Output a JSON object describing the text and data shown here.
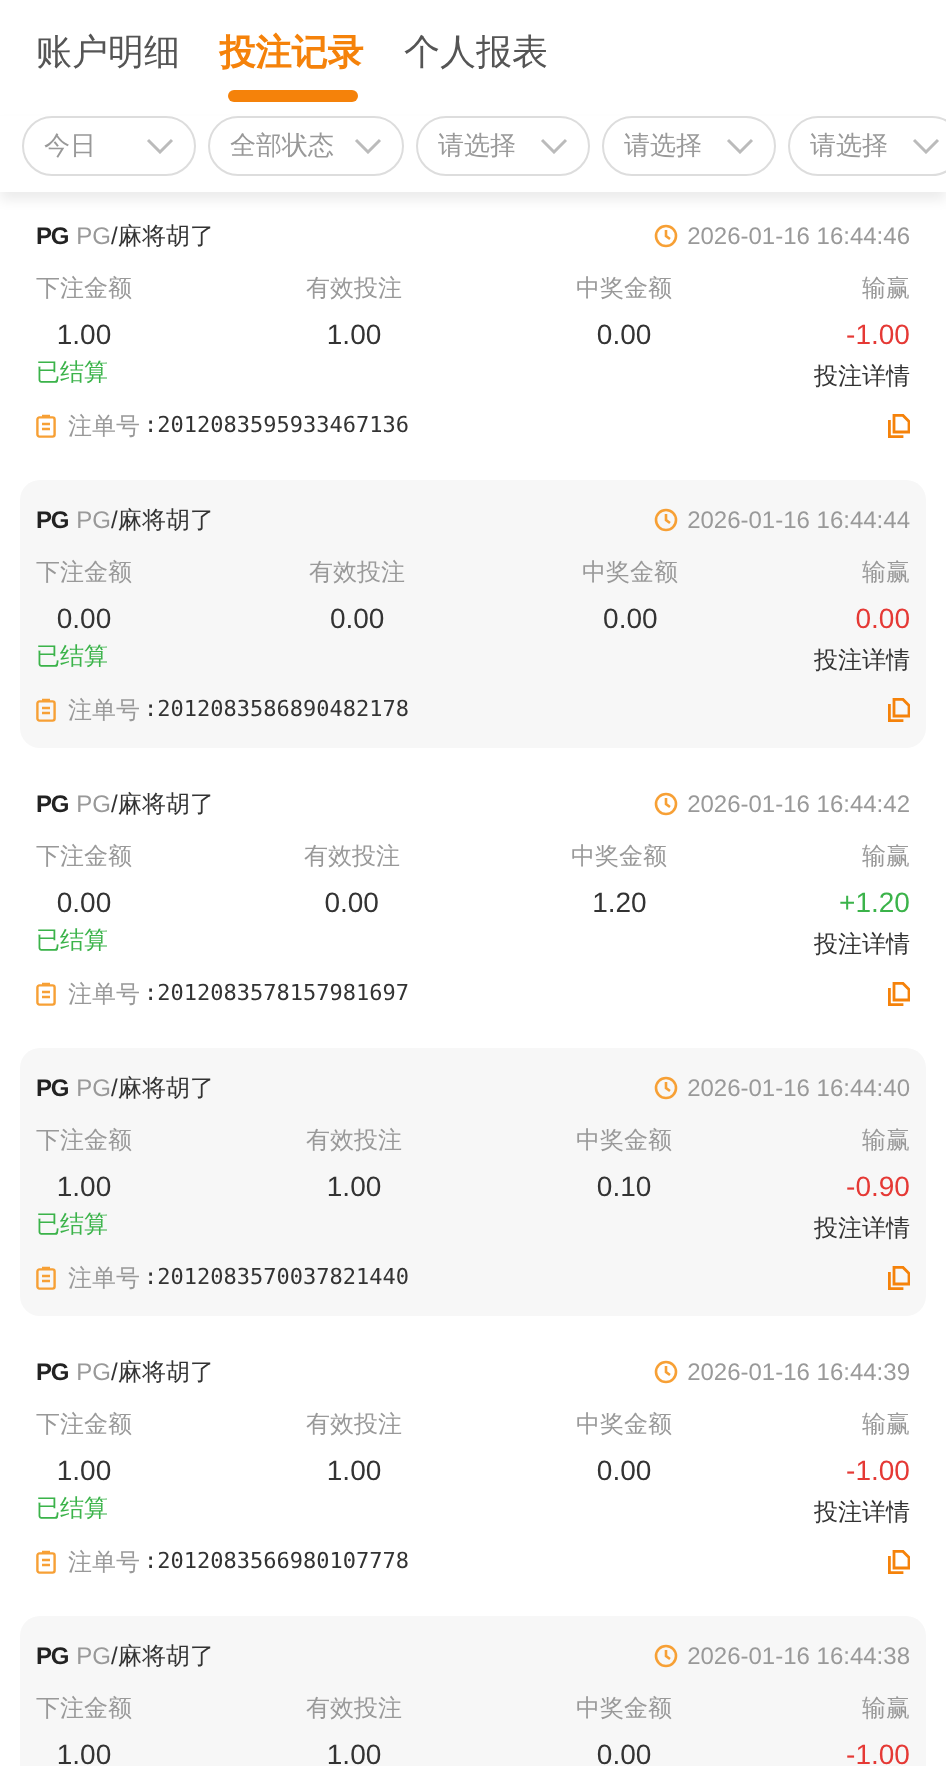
{
  "tabs": [
    {
      "label": "账户明细",
      "selected": false
    },
    {
      "label": "投注记录",
      "selected": true
    },
    {
      "label": "个人报表",
      "selected": false
    }
  ],
  "filters": [
    "今日",
    "全部状态",
    "请选择",
    "请选择",
    "请选择"
  ],
  "records": [
    {
      "logo": "PG",
      "provider": "PG",
      "game": "/麻将胡了",
      "time": "2026-01-16 16:44:46",
      "columns": [
        "下注金额",
        "有效投注",
        "中奖金额",
        "输赢"
      ],
      "values": [
        "1.00",
        "1.00",
        "0.00"
      ],
      "profit": "-1.00",
      "color": "#e53935",
      "status": "已结算",
      "detail": "投注详情",
      "order_label": "注单号",
      "order_no": ":2012083595933467136"
    },
    {
      "logo": "PG",
      "provider": "PG",
      "game": "/麻将胡了",
      "time": "2026-01-16 16:44:44",
      "columns": [
        "下注金额",
        "有效投注",
        "中奖金额",
        "输赢"
      ],
      "values": [
        "0.00",
        "0.00",
        "0.00"
      ],
      "profit": "0.00",
      "color": "#e53935",
      "status": "已结算",
      "detail": "投注详情",
      "order_label": "注单号",
      "order_no": ":2012083586890482178"
    },
    {
      "logo": "PG",
      "provider": "PG",
      "game": "/麻将胡了",
      "time": "2026-01-16 16:44:42",
      "columns": [
        "下注金额",
        "有效投注",
        "中奖金额",
        "输赢"
      ],
      "values": [
        "0.00",
        "0.00",
        "1.20"
      ],
      "profit": "+1.20",
      "color": "#3bb34a",
      "status": "已结算",
      "detail": "投注详情",
      "order_label": "注单号",
      "order_no": ":2012083578157981697"
    },
    {
      "logo": "PG",
      "provider": "PG",
      "game": "/麻将胡了",
      "time": "2026-01-16 16:44:40",
      "columns": [
        "下注金额",
        "有效投注",
        "中奖金额",
        "输赢"
      ],
      "values": [
        "1.00",
        "1.00",
        "0.10"
      ],
      "profit": "-0.90",
      "color": "#e53935",
      "status": "已结算",
      "detail": "投注详情",
      "order_label": "注单号",
      "order_no": ":2012083570037821440"
    },
    {
      "logo": "PG",
      "provider": "PG",
      "game": "/麻将胡了",
      "time": "2026-01-16 16:44:39",
      "columns": [
        "下注金额",
        "有效投注",
        "中奖金额",
        "输赢"
      ],
      "values": [
        "1.00",
        "1.00",
        "0.00"
      ],
      "profit": "-1.00",
      "color": "#e53935",
      "status": "已结算",
      "detail": "投注详情",
      "order_label": "注单号",
      "order_no": ":2012083566980107778"
    },
    {
      "logo": "PG",
      "provider": "PG",
      "game": "/麻将胡了",
      "time": "2026-01-16 16:44:38",
      "columns": [
        "下注金额",
        "有效投注",
        "中奖金额",
        "输赢"
      ],
      "values": [
        "1.00",
        "1.00",
        "0.00"
      ],
      "profit": "-1.00",
      "color": "#e53935"
    }
  ]
}
